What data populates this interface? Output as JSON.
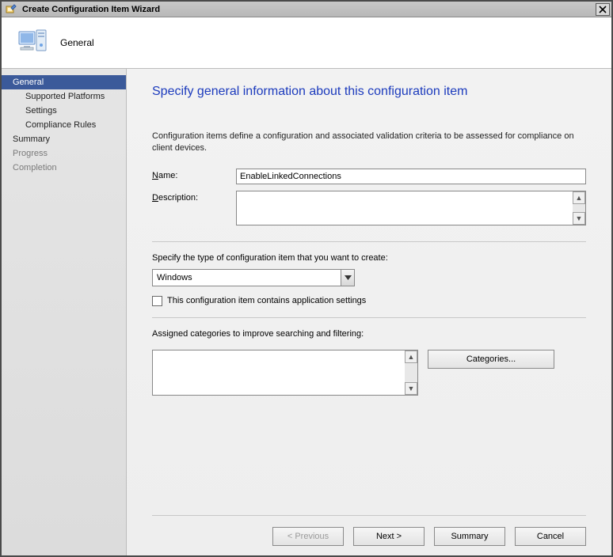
{
  "window": {
    "title": "Create Configuration Item Wizard"
  },
  "header": {
    "label": "General"
  },
  "sidebar": {
    "items": [
      {
        "label": "General",
        "selected": true,
        "sub": false,
        "muted": false
      },
      {
        "label": "Supported Platforms",
        "selected": false,
        "sub": true,
        "muted": false
      },
      {
        "label": "Settings",
        "selected": false,
        "sub": true,
        "muted": false
      },
      {
        "label": "Compliance Rules",
        "selected": false,
        "sub": true,
        "muted": false
      },
      {
        "label": "Summary",
        "selected": false,
        "sub": false,
        "muted": false
      },
      {
        "label": "Progress",
        "selected": false,
        "sub": false,
        "muted": true
      },
      {
        "label": "Completion",
        "selected": false,
        "sub": false,
        "muted": true
      }
    ]
  },
  "page": {
    "title": "Specify general information about this configuration item",
    "intro": "Configuration items define a configuration and associated validation criteria to be assessed for compliance on client devices.",
    "name_label": "Name:",
    "name_value": "EnableLinkedConnections",
    "description_label": "Description:",
    "description_value": "",
    "type_label": "Specify the type of configuration item that you want to create:",
    "type_value": "Windows",
    "checkbox_label": "This configuration item contains application settings",
    "checkbox_checked": false,
    "categories_label": "Assigned categories to improve searching and filtering:",
    "categories_button": "Categories..."
  },
  "footer": {
    "previous": "< Previous",
    "next": "Next >",
    "summary": "Summary",
    "cancel": "Cancel"
  }
}
